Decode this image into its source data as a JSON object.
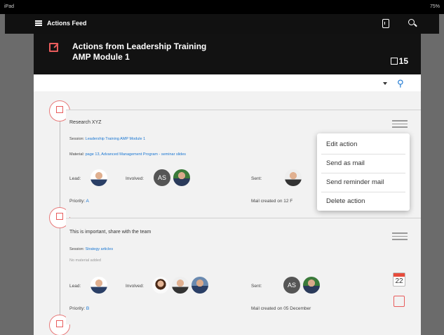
{
  "statusbar": {
    "device": "iPad",
    "battery": "75%"
  },
  "appbar": {
    "title": "Actions Feed"
  },
  "hero": {
    "title_line1": "Actions from Leadership Training",
    "title_line2": "AMP Module 1",
    "count": "15"
  },
  "actions": [
    {
      "title": "Research XYZ",
      "session_label": "Session:",
      "session_value": "Leadership Training AMP Module 1",
      "material_label": "Material:",
      "material_value": "page 13, Advanced Management Program - seminar slides",
      "lead_label": "Lead:",
      "involved_label": "Involved:",
      "involved_initials": "AS",
      "sent_label": "Sent:",
      "priority_label": "Priority:",
      "priority_value": "A",
      "mail_created": "Mail created on 12 F"
    },
    {
      "title": "This is important, share with the team",
      "session_label": "Session:",
      "session_value": "Strategy articles",
      "no_material": "No material added",
      "lead_label": "Lead:",
      "involved_label": "Involved:",
      "sent_label": "Sent:",
      "sent_initials": "AS",
      "priority_label": "Priority:",
      "priority_value": "B",
      "mail_created": "Mail created on 05 December",
      "calendar_day": "22"
    }
  ],
  "context_menu": {
    "items": [
      "Edit action",
      "Send as mail",
      "Send reminder mail",
      "Delete action"
    ]
  },
  "colors": {
    "accent_red": "#e85c5c",
    "link_blue": "#1976d2",
    "header_bg": "#121212"
  }
}
